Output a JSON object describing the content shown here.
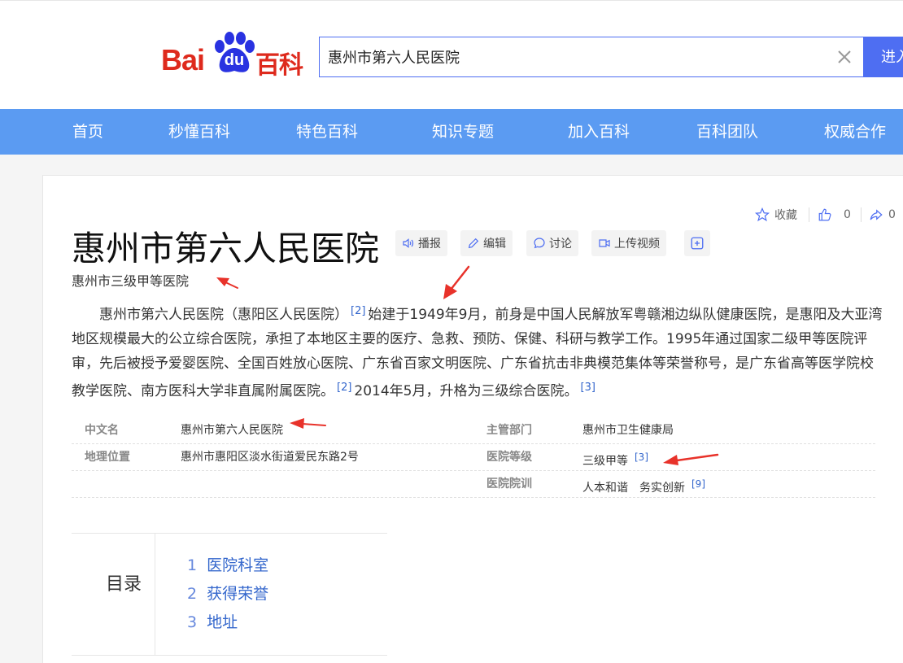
{
  "header": {
    "logo_bai": "Bai",
    "logo_du": "du",
    "logo_baike": "百科",
    "search_value": "惠州市第六人民医院",
    "enter_label": "进入"
  },
  "nav": {
    "items": [
      "首页",
      "秒懂百科",
      "特色百科",
      "知识专题",
      "加入百科",
      "百科团队",
      "权威合作"
    ]
  },
  "toolbar": {
    "collect_label": "收藏",
    "like_count": "0",
    "share_count": "0"
  },
  "entry": {
    "title": "惠州市第六人民医院",
    "buttons": {
      "broadcast": "播报",
      "edit": "编辑",
      "discuss": "讨论",
      "upload_video": "上传视频"
    },
    "subtitle": "惠州市三级甲等医院",
    "summary": {
      "p1": "惠州市第六人民医院（惠阳区人民医院）",
      "ref1": "[2]",
      "p2": "始建于1949年9月，前身是中国人民解放军粤赣湘边纵队健康医院，是惠阳及大亚湾地区规模最大的公立综合医院，承担了本地区主要的医疗、急救、预防、保健、科研与教学工作。1995年通过国家二级甲等医院评审，先后被授予爱婴医院、全国百姓放心医院、广东省百家文明医院、广东省抗击非典模范集体等荣誉称号，是广东省高等医学院校教学医院、南方医科大学非直属附属医院。",
      "ref2": "[2]",
      "p3": "2014年5月，升格为三级综合医院。",
      "ref3": "[3]"
    }
  },
  "basic_info": {
    "rows": [
      {
        "label_l": "中文名",
        "value_l": "惠州市第六人民医院",
        "label_r": "主管部门",
        "value_r": "惠州市卫生健康局",
        "ref_r": ""
      },
      {
        "label_l": "地理位置",
        "value_l": "惠州市惠阳区淡水街道爱民东路2号",
        "label_r": "医院等级",
        "value_r": "三级甲等",
        "ref_r": "[3]"
      },
      {
        "label_l": "",
        "value_l": "",
        "label_r": "医院院训",
        "value_r": "人本和谐　务实创新",
        "ref_r": "[9]"
      }
    ]
  },
  "toc": {
    "title": "目录",
    "items": [
      {
        "num": "1",
        "label": "医院科室"
      },
      {
        "num": "2",
        "label": "获得荣誉"
      },
      {
        "num": "3",
        "label": "地址"
      }
    ]
  },
  "colors": {
    "brand_red": "#de2a1d",
    "brand_blue": "#4e6ef2",
    "nav_blue": "#5b9bf2",
    "link_blue": "#3366cc",
    "annotation_red": "#e8322a"
  }
}
